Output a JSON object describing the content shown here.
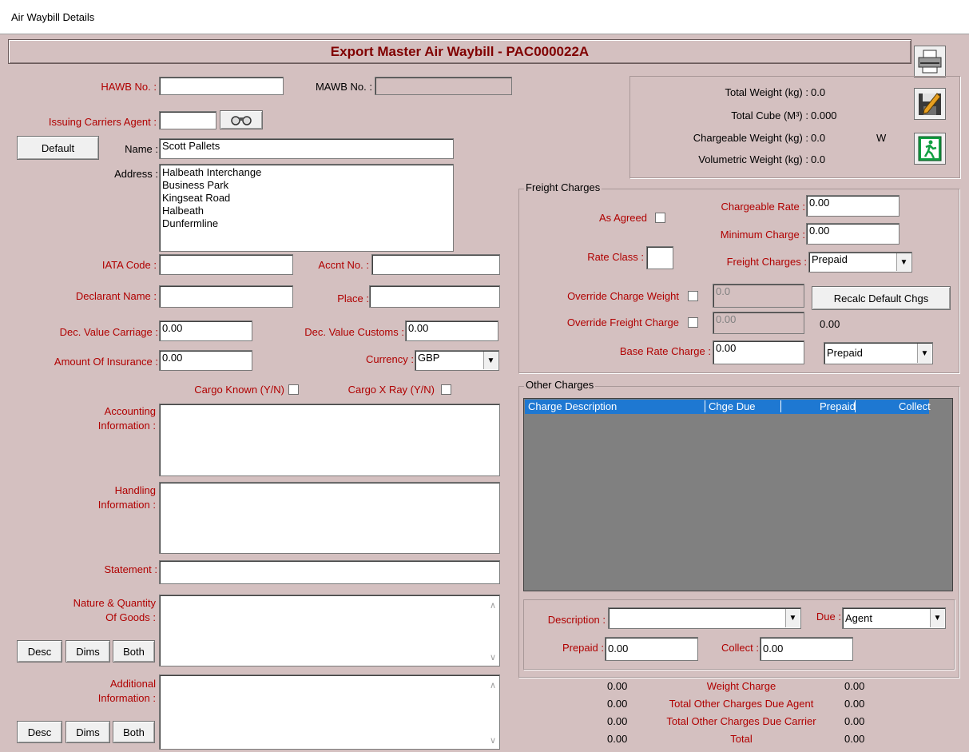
{
  "window": {
    "title": "Air Waybill Details"
  },
  "header": {
    "title": "Export Master Air Waybill - PAC000022A"
  },
  "left": {
    "hawb_label": "HAWB No. :",
    "hawb_value": "",
    "mawb_label": "MAWB No. :",
    "mawb_value": "",
    "issuing_agent_label": "Issuing Carriers Agent :",
    "issuing_agent_value": "",
    "default_button": "Default",
    "name_label": "Name :",
    "name_value": "Scott Pallets",
    "address_label": "Address :",
    "address_value": "Halbeath Interchange\nBusiness Park\nKingseat Road\nHalbeath\nDunfermline",
    "iata_label": "IATA Code :",
    "iata_value": "",
    "accnt_label": "Accnt No. :",
    "accnt_value": "",
    "declarant_label": "Declarant Name :",
    "declarant_value": "",
    "place_label": "Place :",
    "place_value": "",
    "dec_carriage_label": "Dec. Value Carriage :",
    "dec_carriage_value": "0.00",
    "dec_customs_label": "Dec. Value Customs :",
    "dec_customs_value": "0.00",
    "insurance_label": "Amount Of Insurance :",
    "insurance_value": "0.00",
    "currency_label": "Currency :",
    "currency_value": "GBP",
    "cargo_known_label": "Cargo Known (Y/N)",
    "cargo_xray_label": "Cargo X Ray (Y/N)",
    "accounting_label": "Accounting\nInformation :",
    "handling_label": "Handling\nInformation :",
    "statement_label": "Statement :",
    "nature_label": "Nature & Quantity\nOf Goods :",
    "additional_label": "Additional\nInformation :",
    "desc_button": "Desc",
    "dims_button": "Dims",
    "both_button": "Both"
  },
  "totals": {
    "total_weight_label": "Total Weight (kg) :",
    "total_weight_value": "0.0",
    "total_cube_label": "Total Cube (M³) :",
    "total_cube_value": "0.000",
    "chargeable_weight_label": "Chargeable Weight (kg) :",
    "chargeable_weight_value": "0.0",
    "chargeable_flag": "W",
    "volumetric_weight_label": "Volumetric Weight (kg) :",
    "volumetric_weight_value": "0.0"
  },
  "freight": {
    "group_title": "Freight Charges",
    "as_agreed_label": "As Agreed",
    "chargeable_rate_label": "Chargeable Rate :",
    "chargeable_rate_value": "0.00",
    "minimum_charge_label": "Minimum Charge :",
    "minimum_charge_value": "0.00",
    "rate_class_label": "Rate Class :",
    "rate_class_value": "",
    "freight_charges_label": "Freight Charges :",
    "freight_charges_value": "Prepaid",
    "override_weight_label": "Override Charge Weight",
    "override_weight_value": "0.0",
    "override_freight_label": "Override Freight Charge",
    "override_freight_value": "0.00",
    "override_freight_display": "0.00",
    "recalc_button": "Recalc Default Chgs",
    "base_rate_label": "Base Rate Charge :",
    "base_rate_value": "0.00",
    "base_rate_payment": "Prepaid"
  },
  "other": {
    "group_title": "Other Charges",
    "columns": [
      "Charge Description",
      "Chge Due",
      "Prepaid",
      "Collect"
    ],
    "description_label": "Description :",
    "description_value": "",
    "due_label": "Due :",
    "due_value": "Agent",
    "prepaid_label": "Prepaid :",
    "prepaid_value": "0.00",
    "collect_label": "Collect :",
    "collect_value": "0.00"
  },
  "summary": {
    "rows": [
      {
        "left": "0.00",
        "label": "Weight Charge",
        "right": "0.00"
      },
      {
        "left": "0.00",
        "label": "Total Other Charges Due Agent",
        "right": "0.00"
      },
      {
        "left": "0.00",
        "label": "Total Other Charges Due Carrier",
        "right": "0.00"
      },
      {
        "left": "0.00",
        "label": "Total",
        "right": "0.00"
      }
    ]
  },
  "toolbar": {
    "icons": [
      "printer-icon",
      "save-edit-icon",
      "exit-icon"
    ]
  }
}
